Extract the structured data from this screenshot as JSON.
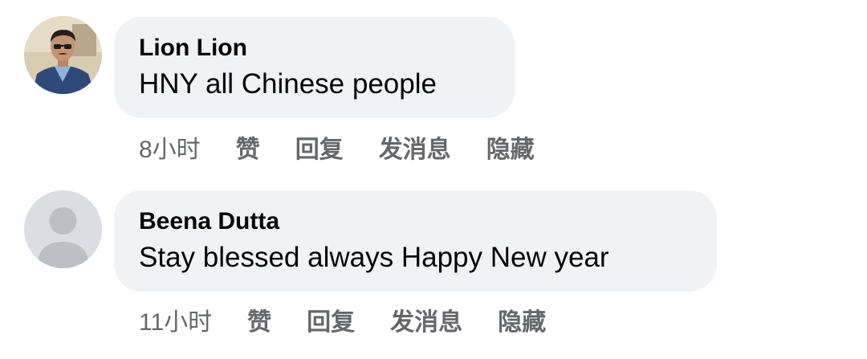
{
  "comments": [
    {
      "author": "Lion Lion",
      "text": "HNY all Chinese people",
      "time": "8小时",
      "actions": {
        "like": "赞",
        "reply": "回复",
        "message": "发消息",
        "hide": "隐藏"
      },
      "avatar_icon": "user-photo-avatar"
    },
    {
      "author": "Beena Dutta",
      "text": "Stay blessed always Happy New year",
      "time": "11小时",
      "actions": {
        "like": "赞",
        "reply": "回复",
        "message": "发消息",
        "hide": "隐藏"
      },
      "avatar_icon": "default-profile-avatar"
    }
  ],
  "colors": {
    "bubble_bg": "#f0f2f5",
    "text": "#050505",
    "meta": "#65676b",
    "default_avatar_bg": "#dadde1",
    "default_avatar_fg": "#bcc0c4"
  }
}
